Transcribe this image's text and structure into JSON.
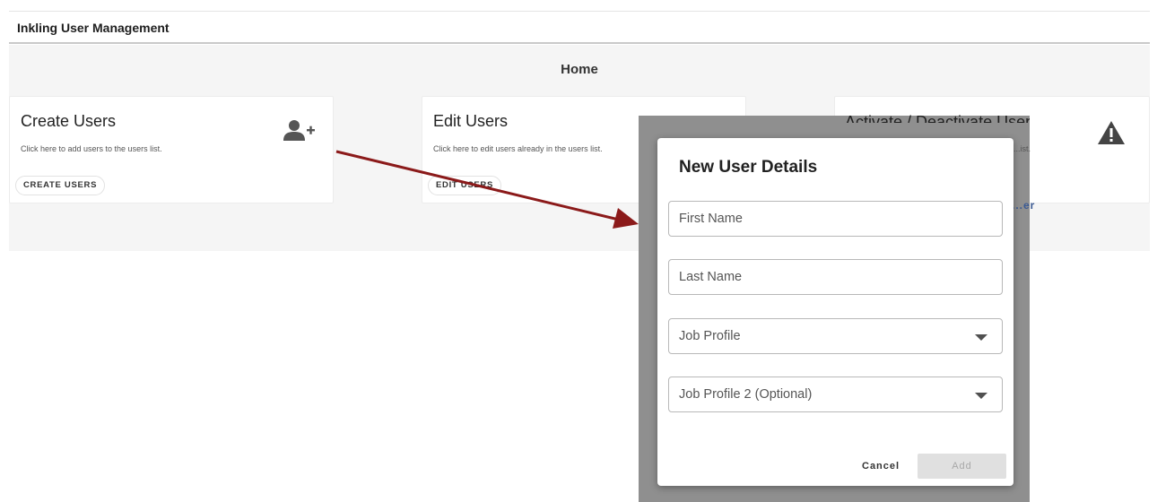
{
  "app": {
    "title": "Inkling User Management"
  },
  "home": {
    "title": "Home"
  },
  "cards": [
    {
      "title": "Create Users",
      "description": "Click here to add users to the users list.",
      "button": "CREATE USERS",
      "icon": "add-user-icon"
    },
    {
      "title": "Edit Users",
      "description": "Click here to edit users already in the users list.",
      "button": "EDIT USERS",
      "icon": ""
    },
    {
      "title": "Activate / Deactivate User",
      "description": "...ist.",
      "button": "...er",
      "icon": "warning-icon"
    }
  ],
  "dialog": {
    "title": "New User Details",
    "fields": [
      {
        "label": "First Name",
        "type": "text"
      },
      {
        "label": "Last Name",
        "type": "text"
      },
      {
        "label": "Job Profile",
        "type": "select"
      },
      {
        "label": "Job Profile 2 (Optional)",
        "type": "select"
      }
    ],
    "cancel": "Cancel",
    "add": "Add"
  },
  "colors": {
    "annotation_arrow": "#8b1a1a",
    "overlay": "#8f8f8f",
    "link_blue": "#3c5b94"
  }
}
